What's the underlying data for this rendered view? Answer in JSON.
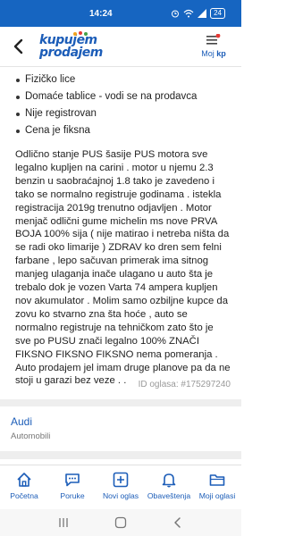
{
  "status_bar": {
    "time": "14:24",
    "battery": "24"
  },
  "header": {
    "logo_top": "kupujem",
    "logo_bottom": "prodajem",
    "my_kp_prefix": "Moj",
    "my_kp_suffix": "kp"
  },
  "features": [
    "Fizičko lice",
    "Domaće tablice - vodi se na prodavca",
    "Nije registrovan",
    "Cena je fiksna"
  ],
  "description": "Odlično stanje PUS šasije PUS motora  sve legalno kupljen na carini . motor u njemu 2.3 benzin u saobraćajnoj 1.8 tako je zavedeno i tako se normalno registruje godinama  . istekla registracija 2019g trenutno odjavljen  . Motor menjač odlični gume michelin ms  nove  PRVA BOJA 100% sija ( nije matirao i netreba ništa da se radi oko limarije ) ZDRAV ko dren sem felni farbane , lepo sačuvan primerak ima sitnog manjeg ulaganja inače ulagano u auto šta je trebalo dok je vozen Varta 74 ampera  kupljen nov akumulator . Molim samo ozbiljne kupce da zovu ko stvarno zna šta hoće , auto se normalno registruje na tehničkom zato što je sve po PUSU znači legalno 100% ZNAČI FIKSNO FIKSNO FIKSNO nema pomeranja . Auto prodajem jel imam druge planove pa da ne stoji u garazi bez veze . .",
  "ad_id": "ID oglasa: #175297240",
  "category": {
    "title": "Audi",
    "subtitle": "Automobili"
  },
  "bottom_nav": [
    {
      "label": "Početna",
      "icon": "home-icon"
    },
    {
      "label": "Poruke",
      "icon": "chat-icon"
    },
    {
      "label": "Novi oglas",
      "icon": "add-icon"
    },
    {
      "label": "Obaveštenja",
      "icon": "bell-icon"
    },
    {
      "label": "Moji oglasi",
      "icon": "folder-icon"
    }
  ],
  "colors": {
    "brand_blue": "#1c5db8",
    "status_bar": "#1665c1"
  }
}
